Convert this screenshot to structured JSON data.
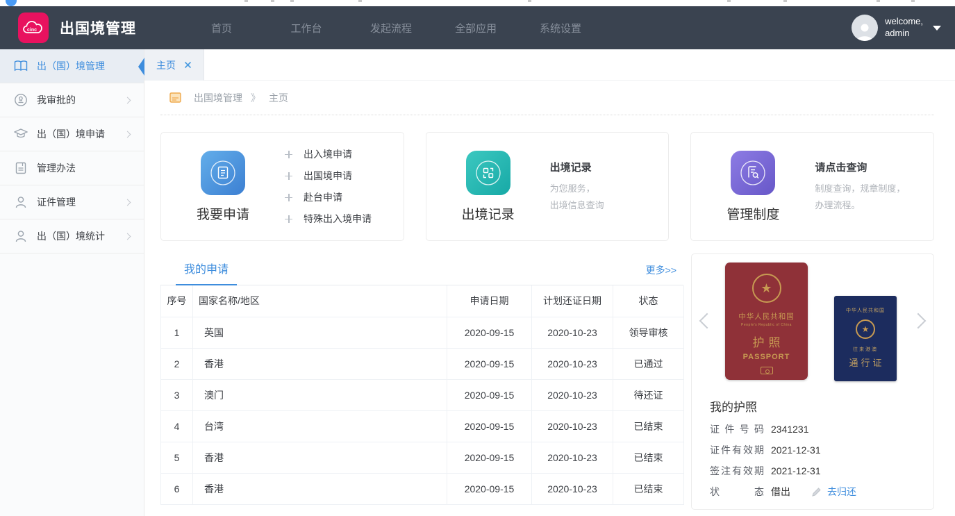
{
  "colors": {
    "navbar_bg": "#3a4350",
    "logo_bg": "#e8125f",
    "accent_blue": "#3e8ddd",
    "card_icon_blue": "#3c7fd2",
    "card_icon_teal": "#17a9a6",
    "card_icon_purple": "#6757c8",
    "passport_red": "#8f3138",
    "passport_blue": "#1c2c5e",
    "passport_gold": "#c79a52"
  },
  "topbar": {
    "logo_text": "Ccinc",
    "app_title": "出国境管理",
    "nav_items": [
      "首页",
      "工作台",
      "发起流程",
      "全部应用",
      "系统设置"
    ],
    "welcome_line1": "welcome,",
    "welcome_line2": "admin"
  },
  "sidebar": {
    "items": [
      {
        "label": "出（国）境管理"
      },
      {
        "label": "我审批的"
      },
      {
        "label": "出（国）境申请"
      },
      {
        "label": "管理办法"
      },
      {
        "label": "证件管理"
      },
      {
        "label": "出（国）境统计"
      }
    ]
  },
  "tabs": {
    "active": "主页"
  },
  "breadcrumb": {
    "root": "出国境管理",
    "separator": "》",
    "current": "主页"
  },
  "cards": {
    "apply": {
      "title": "我要申请",
      "links": [
        "出入境申请",
        "出国境申请",
        "赴台申请",
        "特殊出入境申请"
      ]
    },
    "records": {
      "title": "出境记录",
      "heading": "出境记录",
      "desc1": "为您服务，",
      "desc2": "出境信息查询"
    },
    "policy": {
      "title": "管理制度",
      "heading": "请点击查询",
      "desc1": "制度查询，规章制度，",
      "desc2": "办理流程。"
    }
  },
  "applications": {
    "tab": "我的申请",
    "more": "更多>>",
    "columns": [
      "序号",
      "国家名称/地区",
      "申请日期",
      "计划还证日期",
      "状态"
    ],
    "rows": [
      [
        "1",
        "英国",
        "2020-09-15",
        "2020-10-23",
        "领导审核"
      ],
      [
        "2",
        "香港",
        "2020-09-15",
        "2020-10-23",
        "已通过"
      ],
      [
        "3",
        "澳门",
        "2020-09-15",
        "2020-10-23",
        "待还证"
      ],
      [
        "4",
        "台湾",
        "2020-09-15",
        "2020-10-23",
        "已结束"
      ],
      [
        "5",
        "香港",
        "2020-09-15",
        "2020-10-23",
        "已结束"
      ],
      [
        "6",
        "香港",
        "2020-09-15",
        "2020-10-23",
        "已结束"
      ]
    ]
  },
  "passport_panel": {
    "red": {
      "line1": "中华人民共和国",
      "line2": "People's Republic of China",
      "line3": "护照",
      "line4": "PASSPORT"
    },
    "blue": {
      "line1": "中华人民共和国",
      "line2": "往来港澳",
      "line3": "通行证"
    },
    "title": "我的护照",
    "fields": {
      "number_label": "证件号码",
      "number_value": "2341231",
      "valid_label": "证件有效期",
      "valid_value": "2021-12-31",
      "visa_label": "签注有效期",
      "visa_value": "2021-12-31",
      "status_label": "状态",
      "status_value": "借出",
      "return_link": "去归还"
    }
  }
}
